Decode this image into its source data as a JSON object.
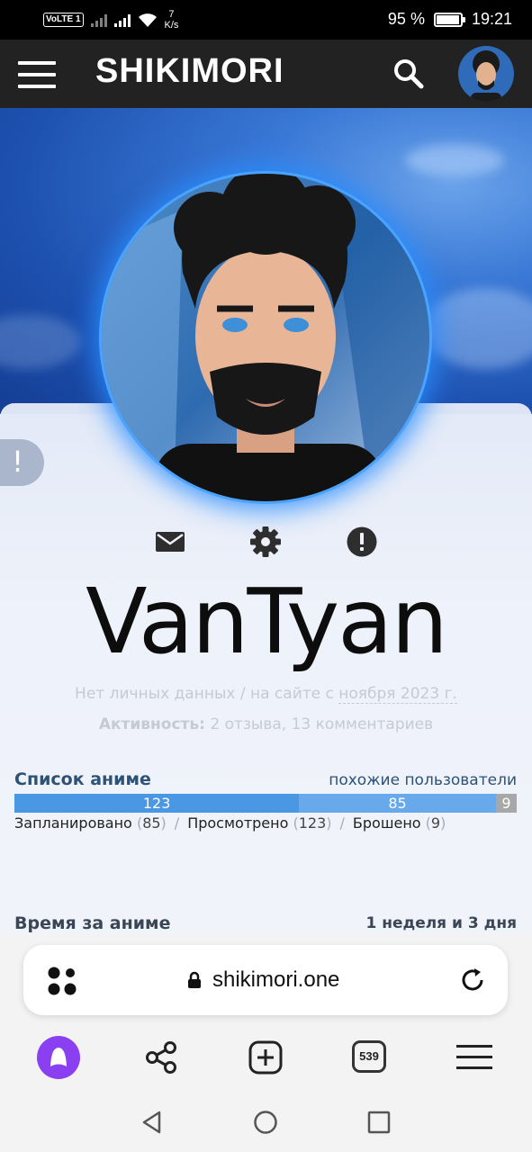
{
  "status_bar": {
    "volte": "VoLTE",
    "sim": "1",
    "speed_value": "7",
    "speed_unit": "K/s",
    "battery_percent": "95 %",
    "battery_level": 0.95,
    "time": "19:21"
  },
  "header": {
    "logo": "SHIKIMORI",
    "menu_icon": "hamburger-icon",
    "search_icon": "search-icon",
    "avatar_icon": "user-avatar"
  },
  "profile": {
    "notice_tab": "!",
    "action_icons": [
      "mail-icon",
      "settings-gear-icon",
      "report-icon"
    ],
    "username": "VanTyan",
    "info": {
      "no_data": "Нет личных данных",
      "separator": "/",
      "on_site_prefix": "на сайте с",
      "since": "ноября 2023 г."
    },
    "activity": {
      "label": "Активность:",
      "reviews": "2 отзыва",
      "comma": ",",
      "comments": "13 комментариев"
    }
  },
  "anime_list": {
    "title": "Список аниме",
    "similar_users": "похожие пользователи",
    "bar": [
      {
        "label": "123",
        "value": 123,
        "color": "#4a97e3"
      },
      {
        "label": "85",
        "value": 85,
        "color": "#67a9ea"
      },
      {
        "label": "9",
        "value": 9,
        "color": "#a8a8a8"
      }
    ],
    "stats": [
      {
        "label": "Запланировано",
        "count": "85"
      },
      {
        "label": "Просмотрено",
        "count": "123"
      },
      {
        "label": "Брошено",
        "count": "9"
      }
    ],
    "open_paren": "(",
    "close_paren": ")",
    "separator": "/"
  },
  "time_section": {
    "title": "Время за аниме",
    "value": "1 неделя и 3 дня"
  },
  "browser": {
    "url": "shikimori.one",
    "lock_icon": "lock-icon",
    "apps_icon": "apps-dots-icon",
    "reload_icon": "reload-icon",
    "tabs_count": "539",
    "nav_icons": [
      "alice-assistant-icon",
      "share-icon",
      "new-tab-icon",
      "tabs-icon",
      "menu-icon"
    ]
  },
  "system_nav": [
    "back-icon",
    "home-icon",
    "recents-icon"
  ],
  "colors": {
    "header_bg": "#222222",
    "link": "#2d5276",
    "accent_blue": "#4a97e3",
    "alice_purple": "#8a3ff0"
  }
}
